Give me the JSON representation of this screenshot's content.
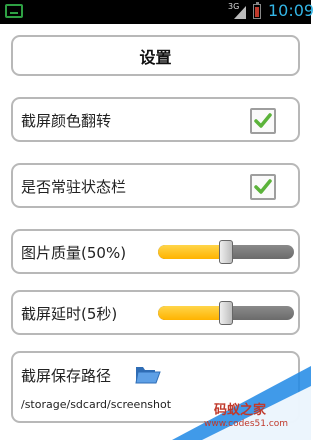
{
  "status_bar": {
    "network": "3G",
    "time": "10:09",
    "accent": "#33b5e5"
  },
  "header": {
    "title": "设置"
  },
  "settings": {
    "invert_colors": {
      "label": "截屏颜色翻转",
      "checked": true
    },
    "persistent_statusbar": {
      "label": "是否常驻状态栏",
      "checked": true
    },
    "image_quality": {
      "label": "图片质量(50%)",
      "value_percent": 50
    },
    "capture_delay": {
      "label": "截屏延时(5秒)",
      "value_seconds": 5,
      "fill_fraction": 0.5
    },
    "save_path": {
      "label": "截屏保存路径",
      "path": "/storage/sdcard/screenshot",
      "icon": "folder-open-icon"
    }
  },
  "watermark": {
    "text": "码蚁之家",
    "url": "www.codes51.com"
  },
  "colors": {
    "check": "#5bb33a",
    "slider_fill": "#ffc107",
    "card_border": "#b8b8b8"
  }
}
